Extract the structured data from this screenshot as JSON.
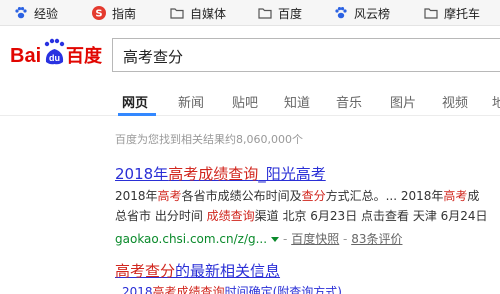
{
  "bookmarks": [
    {
      "label": "经验",
      "icon": "paw-icon"
    },
    {
      "label": "指南",
      "icon": "s-logo-icon"
    },
    {
      "label": "自媒体",
      "icon": "folder-icon"
    },
    {
      "label": "百度",
      "icon": "folder-icon"
    },
    {
      "label": "风云榜",
      "icon": "paw-icon"
    },
    {
      "label": "摩托车",
      "icon": "folder-icon"
    }
  ],
  "logo": {
    "text_left": "Bai",
    "text_mid": "du",
    "text_right": "百度"
  },
  "search": {
    "query": "高考查分"
  },
  "tabs": [
    "网页",
    "新闻",
    "贴吧",
    "知道",
    "音乐",
    "图片",
    "视频",
    "地"
  ],
  "result_count": "百度为您找到相关结果约8,060,000个",
  "result": {
    "title_a": "2018年",
    "title_b": "高考成绩查询",
    "title_c": "_阳光高考",
    "snippet1_a": "2018年",
    "snippet1_b": "高考",
    "snippet1_c": "各省市成绩公布时间及",
    "snippet1_d": "查分",
    "snippet1_e": "方式汇总。... 2018年",
    "snippet1_f": "高考",
    "snippet1_g": "成",
    "snippet2_a": "总省市 出分时间 ",
    "snippet2_b": "成绩查询",
    "snippet2_c": "渠道 北京 6月23日 点击查看 天津 6月24日",
    "url": "gaokao.chsi.com.cn/z/g...",
    "cache": "百度快照",
    "rating": "83条评价"
  },
  "latest": {
    "title_a": "高考查分",
    "title_b": "的最新相关信息",
    "item_a": "2018",
    "item_b": "高考成绩查询",
    "item_c": "时间确定(附查询方式)"
  }
}
